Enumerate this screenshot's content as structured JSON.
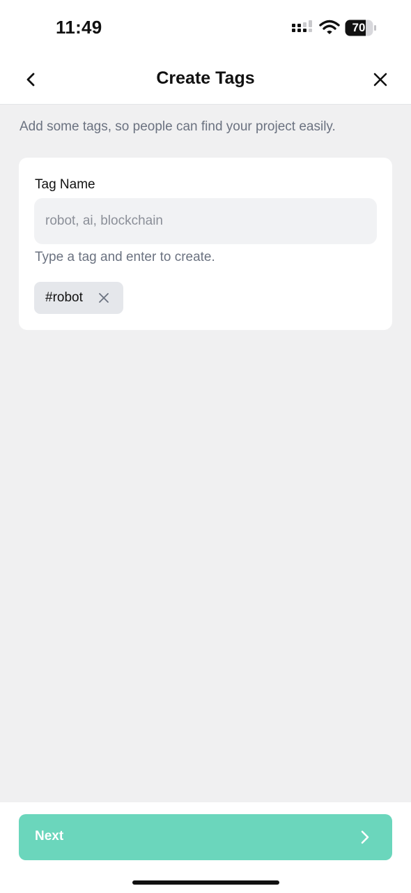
{
  "status_bar": {
    "time": "11:49",
    "battery_level": "70",
    "icons": [
      "signal-icon",
      "wifi-icon",
      "battery-icon"
    ]
  },
  "nav": {
    "title": "Create Tags",
    "back_icon": "chevron-left-icon",
    "close_icon": "close-icon"
  },
  "subtitle": "Add some tags, so people can find your project easily.",
  "form": {
    "label": "Tag Name",
    "input_value": "",
    "placeholder": "robot, ai, blockchain",
    "hint": "Type a tag and enter to create."
  },
  "tags": [
    {
      "label": "#robot",
      "remove_icon": "close-icon"
    }
  ],
  "footer": {
    "next_label": "Next",
    "next_icon": "chevron-right-icon"
  },
  "colors": {
    "accent": "#6bd6bc",
    "background": "#f0f0f1",
    "card": "#ffffff",
    "chip": "#e5e7eb",
    "muted_text": "#6b7280"
  }
}
